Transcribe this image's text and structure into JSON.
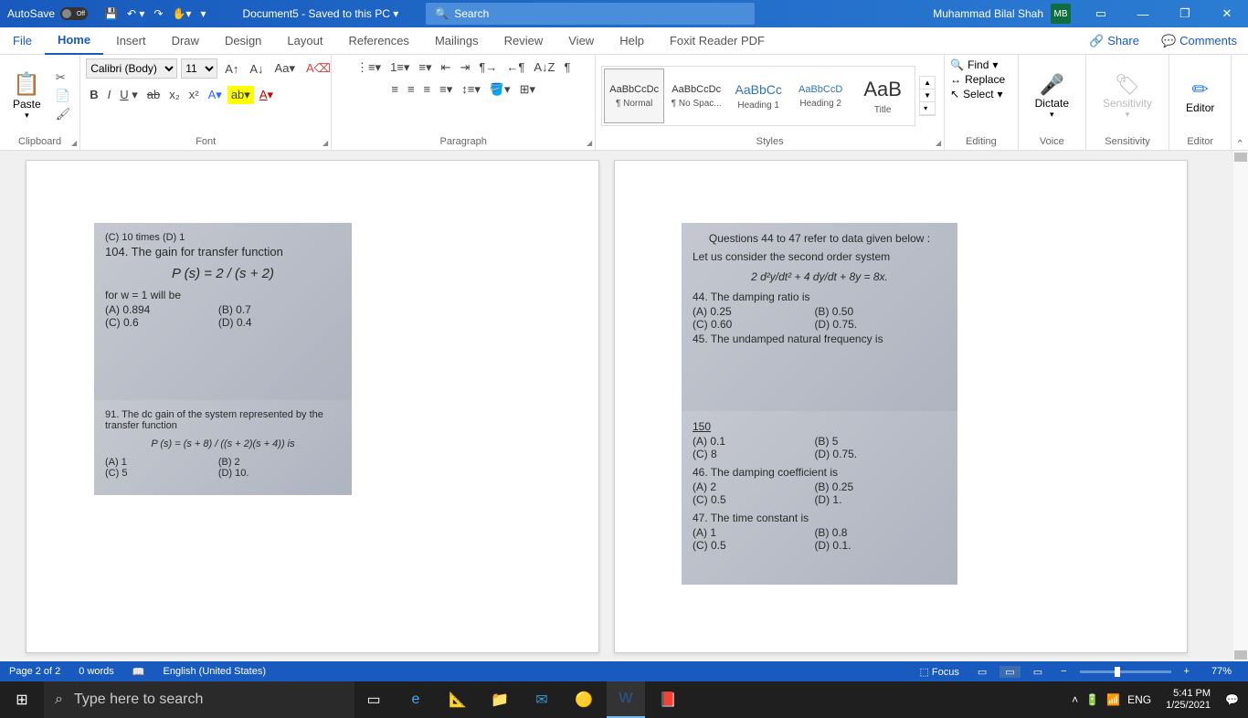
{
  "titlebar": {
    "autosave": "AutoSave",
    "autosave_state": "Off",
    "title": "Document5 - Saved to this PC",
    "search_placeholder": "Search",
    "user_name": "Muhammad Bilal Shah",
    "user_initials": "MB"
  },
  "tabs": {
    "items": [
      "File",
      "Home",
      "Insert",
      "Draw",
      "Design",
      "Layout",
      "References",
      "Mailings",
      "Review",
      "View",
      "Help",
      "Foxit Reader PDF"
    ],
    "share": "Share",
    "comments": "Comments"
  },
  "ribbon": {
    "clipboard": {
      "label": "Clipboard",
      "paste": "Paste"
    },
    "font": {
      "label": "Font",
      "name": "Calibri (Body)",
      "size": "11"
    },
    "paragraph": {
      "label": "Paragraph"
    },
    "styles": {
      "label": "Styles",
      "items": [
        {
          "preview": "AaBbCcDc",
          "name": "¶ Normal",
          "cls": ""
        },
        {
          "preview": "AaBbCcDc",
          "name": "¶ No Spac...",
          "cls": ""
        },
        {
          "preview": "AaBbCc",
          "name": "Heading 1",
          "cls": "h1"
        },
        {
          "preview": "AaBbCcD",
          "name": "Heading 2",
          "cls": "h2"
        },
        {
          "preview": "AaB",
          "name": "Title",
          "cls": "title"
        }
      ]
    },
    "editing": {
      "label": "Editing",
      "find": "Find",
      "replace": "Replace",
      "select": "Select"
    },
    "voice": {
      "label": "Voice",
      "dictate": "Dictate"
    },
    "sensitivity": {
      "label": "Sensitivity",
      "btn": "Sensitivity"
    },
    "editor": {
      "label": "Editor",
      "btn": "Editor"
    }
  },
  "doc": {
    "p1img1": {
      "header": "(C) 10 times          (D) 1",
      "q": "104. The gain for transfer function",
      "formula": "P (s)  =  2 / (s + 2)",
      "cond": "for w = 1 will be",
      "a": "(A) 0.894",
      "b": "(B) 0.7",
      "c": "(C) 0.6",
      "d": "(D) 0.4"
    },
    "p1img2": {
      "q": "91.  The dc gain of the system represented by the transfer function",
      "formula": "P (s)  =  (s + 8) / ((s + 2)(s + 4))   is",
      "a": "(A) 1",
      "b": "(B) 2",
      "c": "(C) 5",
      "d": "(D) 10."
    },
    "p2img1": {
      "header": "Questions 44 to 47 refer to data given below :",
      "intro": "Let us consider the second order system",
      "eq": "2 d²y/dt²  +  4 dy/dt  +  8y  =  8x.",
      "q44": "44.  The damping ratio is",
      "q44a": "(A) 0.25",
      "q44b": "(B) 0.50",
      "q44c": "(C) 0.60",
      "q44d": "(D) 0.75.",
      "q45": "45.  The undamped natural frequency is"
    },
    "p2img2": {
      "top": "150",
      "q45a": "(A) 0.1",
      "q45b": "(B) 5",
      "q45c": "(C) 8",
      "q45d": "(D) 0.75.",
      "q46": "46.  The damping coefficient is",
      "q46a": "(A) 2",
      "q46b": "(B) 0.25",
      "q46c": "(C) 0.5",
      "q46d": "(D) 1.",
      "q47": "47.  The time constant is",
      "q47a": "(A) 1",
      "q47b": "(B) 0.8",
      "q47c": "(C) 0.5",
      "q47d": "(D) 0.1."
    }
  },
  "statusbar": {
    "page": "Page 2 of 2",
    "words": "0 words",
    "lang": "English (United States)",
    "focus": "Focus",
    "zoom": "77%"
  },
  "taskbar": {
    "search_placeholder": "Type here to search",
    "lang": "ENG",
    "time": "5:41 PM",
    "date": "1/25/2021"
  }
}
